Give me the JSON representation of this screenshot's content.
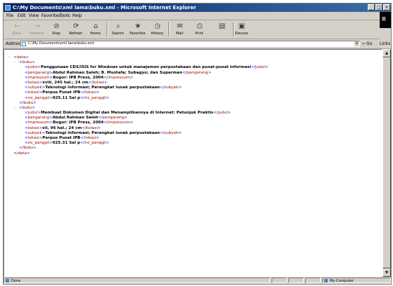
{
  "window": {
    "title": "C:\\My Documents\\xml lama\\buku.xml - Microsoft Internet Explorer",
    "controls": [
      "_",
      "□",
      "×"
    ]
  },
  "menu": [
    "File",
    "Edit",
    "View",
    "Favorites",
    "Tools",
    "Help"
  ],
  "toolbar": {
    "buttons": [
      {
        "label": "Back",
        "icon": "back-arrow-icon",
        "glyph": "←",
        "enabled": false
      },
      {
        "label": "Forward",
        "icon": "forward-arrow-icon",
        "glyph": "→",
        "enabled": false
      },
      {
        "label": "Stop",
        "icon": "stop-icon",
        "glyph": "⊘",
        "enabled": true
      },
      {
        "label": "Refresh",
        "icon": "refresh-icon",
        "glyph": "⟳",
        "enabled": true
      },
      {
        "label": "Home",
        "icon": "home-icon",
        "glyph": "⌂",
        "enabled": true
      },
      {
        "label": "Search",
        "icon": "search-icon",
        "glyph": "⌕",
        "enabled": true
      },
      {
        "label": "Favorites",
        "icon": "favorites-icon",
        "glyph": "★",
        "enabled": true
      },
      {
        "label": "History",
        "icon": "history-icon",
        "glyph": "◷",
        "enabled": true
      },
      {
        "label": "Mail",
        "icon": "mail-icon",
        "glyph": "✉",
        "enabled": true
      },
      {
        "label": "Print",
        "icon": "print-icon",
        "glyph": "⎙",
        "enabled": true
      },
      {
        "label": "",
        "icon": "edit-icon",
        "glyph": "▤",
        "enabled": true
      },
      {
        "label": "Discuss",
        "icon": "discuss-icon",
        "glyph": "▣",
        "enabled": true
      }
    ]
  },
  "address": {
    "label": "Address",
    "value": "C:\\My Documents\\xml lama\\buku.xml",
    "go_label": "Go",
    "links_label": "Links"
  },
  "xml": {
    "root": "data",
    "records": [
      {
        "tag": "buku",
        "fields": [
          {
            "tag": "judul",
            "value": "Penggunaan CDS/ISIS for Windows untuk manajemen perpustakaan dan pusat-pusat informasi"
          },
          {
            "tag": "pengarang",
            "value": "Abdul Rahman Saleh; B. Mustafa; Subagyo; dan Suparman"
          },
          {
            "tag": "impressum",
            "value": "Bogor: IPB Press, 2004"
          },
          {
            "tag": "kolasi",
            "value": "xviii, 245 hal.; 24 cm"
          },
          {
            "tag": "subyek",
            "value": "Teknologi informasi; Perangkat lunak perpustakaan"
          },
          {
            "tag": "lokasi",
            "value": "Perpus Pusat IPB"
          },
          {
            "tag": "no_panggil",
            "value": "025.11 Sal p"
          }
        ]
      },
      {
        "tag": "buku",
        "fields": [
          {
            "tag": "judul",
            "value": "Membuat Dokumen Digital dan Menampilkannya di Internet: Petunjuk Praktis"
          },
          {
            "tag": "pengarang",
            "value": "Abdul Rahman Saleh"
          },
          {
            "tag": "impressum",
            "value": "Bogor: IPB Press, 2004"
          },
          {
            "tag": "kolasi",
            "value": "xii, 96 hal.; 24 cm"
          },
          {
            "tag": "subyek",
            "value": "Teknologi informasi; Perangkat lunak perpustakaan"
          },
          {
            "tag": "lokasi",
            "value": "Perpus Pusat IPB"
          },
          {
            "tag": "no_panggil",
            "value": "025.31 Sal p"
          }
        ]
      }
    ],
    "collapse_marker": "-"
  },
  "status": {
    "left": "Done",
    "zone": "My Computer"
  },
  "colors": {
    "title_bar": "#0a246a",
    "markup_blue": "#0000ff",
    "tag_name": "#990000",
    "collapse_marker": "#ff0000"
  }
}
